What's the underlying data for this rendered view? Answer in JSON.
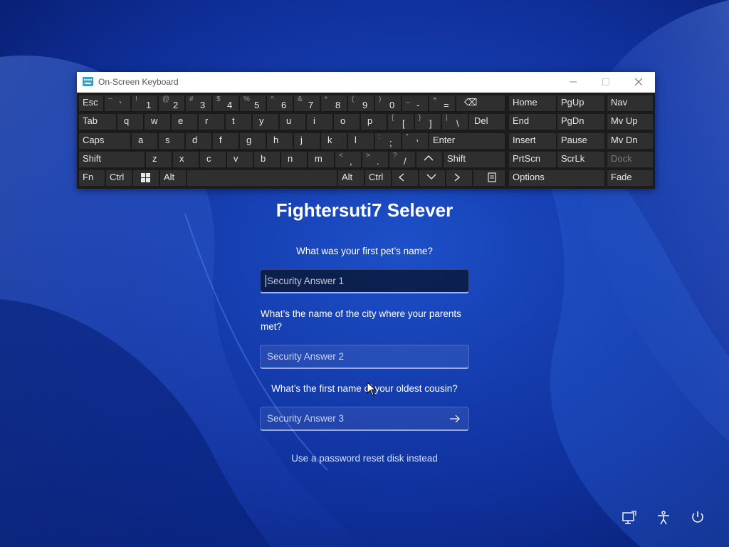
{
  "osk": {
    "title": "On-Screen Keyboard",
    "keys": {
      "esc": "Esc",
      "tilde_shift": "~",
      "tilde_main": "`",
      "d1_shift": "!",
      "d1": "1",
      "d2_shift": "@",
      "d2": "2",
      "d3_shift": "#",
      "d3": "3",
      "d4_shift": "$",
      "d4": "4",
      "d5_shift": "%",
      "d5": "5",
      "d6_shift": "^",
      "d6": "6",
      "d7_shift": "&",
      "d7": "7",
      "d8_shift": "*",
      "d8": "8",
      "d9_shift": "(",
      "d9": "9",
      "d0_shift": ")",
      "d0": "0",
      "minus_shift": "_",
      "minus": "-",
      "equal_shift": "+",
      "equal": "=",
      "backspace": "⌫",
      "home": "Home",
      "pgup": "PgUp",
      "nav": "Nav",
      "tab": "Tab",
      "q": "q",
      "w": "w",
      "e": "e",
      "r": "r",
      "t": "t",
      "y": "y",
      "u": "u",
      "i": "i",
      "o": "o",
      "p": "p",
      "lbracket_shift": "{",
      "lbracket": "[",
      "rbracket_shift": "}",
      "rbracket": "]",
      "backslash_shift": "|",
      "backslash": "\\",
      "del": "Del",
      "end": "End",
      "pgdn": "PgDn",
      "mvup": "Mv Up",
      "caps": "Caps",
      "a": "a",
      "s": "s",
      "d": "d",
      "f": "f",
      "g": "g",
      "h": "h",
      "j": "j",
      "k": "k",
      "l": "l",
      "semicolon_shift": ":",
      "semicolon": ";",
      "quote_shift": "\"",
      "quote": "'",
      "enter": "Enter",
      "insert": "Insert",
      "pause": "Pause",
      "mvdn": "Mv Dn",
      "shift": "Shift",
      "z": "z",
      "x": "x",
      "c": "c",
      "v": "v",
      "b": "b",
      "n": "n",
      "m": "m",
      "comma_shift": "<",
      "comma": ",",
      "period_shift": ">",
      "period": ".",
      "slash_shift": "?",
      "slash": "/",
      "up": "^",
      "rshift": "Shift",
      "prtscn": "PrtScn",
      "scrlk": "ScrLk",
      "dock": "Dock",
      "fn": "Fn",
      "ctrl": "Ctrl",
      "alt": "Alt",
      "ralt": "Alt",
      "rctrl": "Ctrl",
      "left": "<",
      "down": "v",
      "right": ">",
      "options": "Options",
      "fade": "Fade"
    }
  },
  "login": {
    "title": "Fightersuti7 Selever",
    "questions": [
      {
        "text": "What was your first pet’s name?",
        "placeholder": "Security Answer 1"
      },
      {
        "text": "What’s the name of the city where your parents met?",
        "placeholder": "Security Answer 2"
      },
      {
        "text": "What’s the first name of your oldest cousin?",
        "placeholder": "Security Answer 3"
      }
    ],
    "reset_link": "Use a password reset disk instead"
  },
  "icons": {
    "network": "network-icon",
    "accessibility": "accessibility-icon",
    "power": "power-icon",
    "submit": "arrow-right-icon"
  },
  "colors": {
    "wallpaper_base": "#0a2a8a",
    "wallpaper_highlight": "#3a6fe0",
    "osk_background": "#1c1c1c",
    "key_background": "#2f2f2f"
  }
}
